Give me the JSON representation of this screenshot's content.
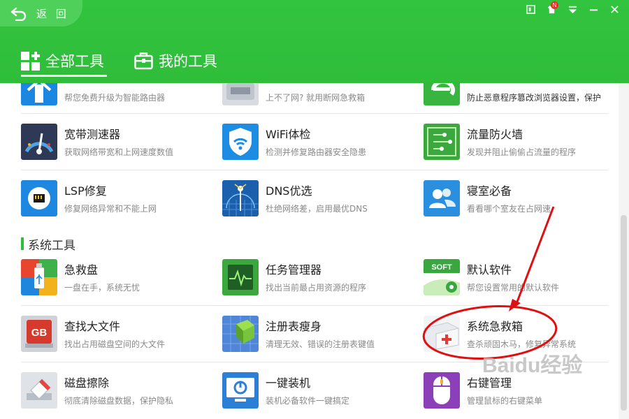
{
  "header": {
    "back_label": "返 回",
    "tabs": [
      {
        "label": "全部工具",
        "active": true
      },
      {
        "label": "我的工具",
        "active": false
      }
    ],
    "notification_badge": "N"
  },
  "sections": [
    {
      "title": "系统工具"
    }
  ],
  "tools": {
    "r0c0": {
      "title": "",
      "desc": "帮您免费升级为智能路由器"
    },
    "r0c1": {
      "title": "",
      "desc": "上不了网? 就用断网急救箱"
    },
    "r0c2": {
      "title": "",
      "desc": "防止恶意程序篡改浏览器设置，保护"
    },
    "r1c0": {
      "title": "宽带测速器",
      "desc": "获取网络带宽和上网速度数值"
    },
    "r1c1": {
      "title": "WiFi体检",
      "desc": "检测并修复路由器安全隐患"
    },
    "r1c2": {
      "title": "流量防火墙",
      "desc": "发现并阻止偷偷占流量的程序"
    },
    "r2c0": {
      "title": "LSP修复",
      "desc": "修复网络异常和不能上网"
    },
    "r2c1": {
      "title": "DNS优选",
      "desc": "杜绝网络差，启用最优DNS"
    },
    "r2c2": {
      "title": "寝室必备",
      "desc": "看看哪个室友在占网速"
    },
    "r3c0": {
      "title": "急救盘",
      "desc": "一盘在手，系统无忧"
    },
    "r3c1": {
      "title": "任务管理器",
      "desc": "找出当前最占用资源的程序"
    },
    "r3c2": {
      "title": "默认软件",
      "desc": "帮您设置常用的默认软件"
    },
    "r4c0": {
      "title": "查找大文件",
      "desc": "找出占用磁盘空间的大文件"
    },
    "r4c1": {
      "title": "注册表瘦身",
      "desc": "清理无效、错误的注册表键值"
    },
    "r4c2": {
      "title": "系统急救箱",
      "desc": "查杀顽固木马，修复异常系统"
    },
    "r5c0": {
      "title": "磁盘擦除",
      "desc": "彻底清除磁盘数据，保护隐私"
    },
    "r5c1": {
      "title": "一键装机",
      "desc": "装机必备软件一键搞定"
    },
    "r5c2": {
      "title": "右键管理",
      "desc": "管理鼠标的右键菜单"
    }
  },
  "icon_labels": {
    "gb": "GB",
    "soft": "SOFT"
  },
  "watermark": "Baidu经验",
  "colors": {
    "brand_green": "#2fbd3a",
    "annotation_red": "#e01010"
  }
}
